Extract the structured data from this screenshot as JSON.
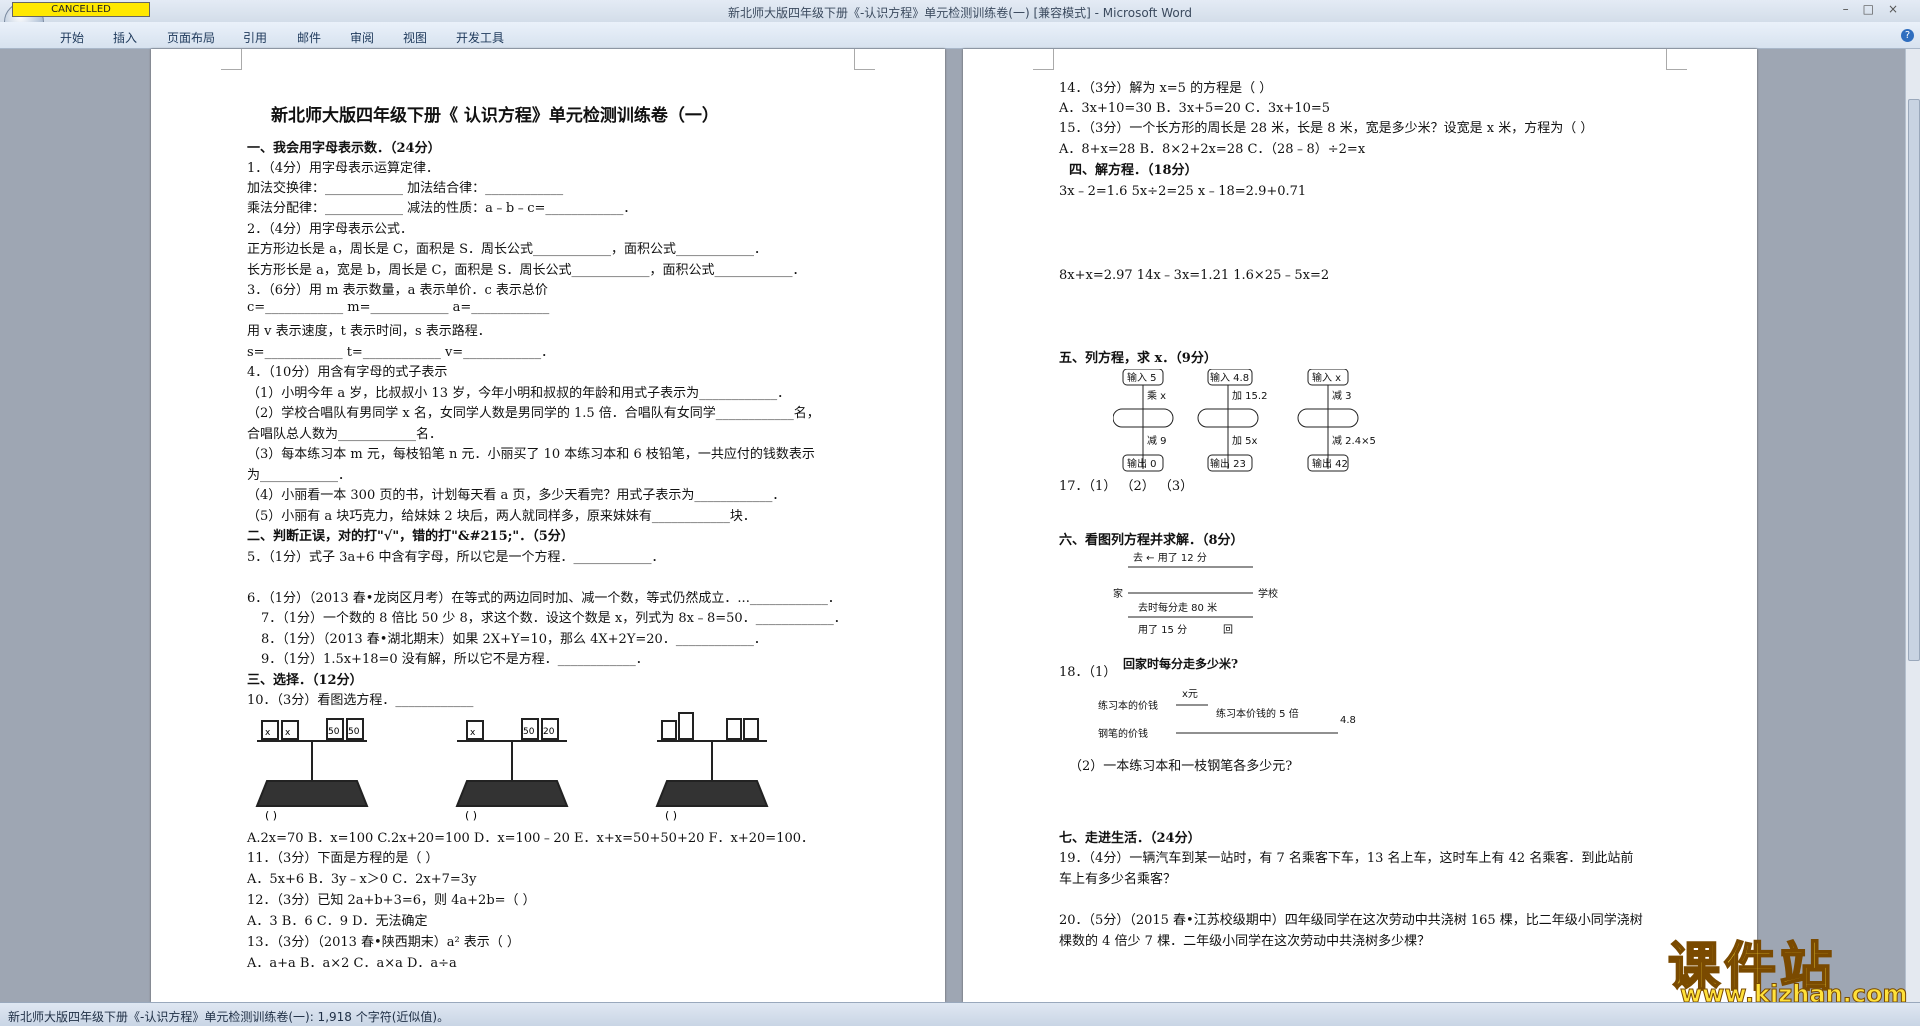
{
  "window": {
    "title": "新北师大版四年级下册《-认识方程》单元检测训练卷(一) [兼容模式] - Microsoft Word",
    "cancelled_label": "CANCELLED",
    "controls": [
      "–",
      "□",
      "×"
    ]
  },
  "ribbon": {
    "tabs": [
      "开始",
      "插入",
      "页面布局",
      "引用",
      "邮件",
      "审阅",
      "视图",
      "开发工具"
    ],
    "help": "?"
  },
  "status": {
    "text": "新北师大版四年级下册《-认识方程》单元检测训练卷(一): 1,918 个字符(近似值)。"
  },
  "watermark": {
    "logo": "课件站",
    "url": "www.kjzhan.com"
  },
  "page1": {
    "title": "新北师大版四年级下册《 认识方程》单元检测训练卷（一）",
    "lines": [
      "一、我会用字母表示数．（24分）",
      "1．（4分）用字母表示运算定律．",
      "加法交换律：____________    加法结合律：____________",
      "乘法分配律：____________    减法的性质：a﹣b﹣c=____________．",
      "2．（4分）用字母表示公式．",
      "正方形边长是 a，周长是 C，面积是 S．周长公式____________，面积公式____________．",
      "长方形长是 a，宽是 b，周长是 C，面积是 S．周长公式____________，面积公式____________．",
      "3．（6分）用 m 表示数量，a 表示单价．c 表示总价",
      "c=____________    m=____________    a=____________",
      "用 v 表示速度，t 表示时间，s 表示路程．",
      "s=____________    t=____________    v=____________．",
      "4．（10分）用含有字母的式子表示",
      "（1）小明今年 a 岁，比叔叔小 13 岁，今年小明和叔叔的年龄和用式子表示为____________．",
      "（2）学校合唱队有男同学 x 名，女同学人数是男同学的 1.5 倍．合唱队有女同学____________名，",
      "合唱队总人数为____________名．",
      "（3）每本练习本 m 元，每枝铅笔 n 元．小丽买了 10 本练习本和 6 枝铅笔，一共应付的钱数表示",
      "为____________．",
      "（4）小丽看一本 300 页的书，计划每天看 a 页，多少天看完？用式子表示为____________．",
      "（5）小丽有 a 块巧克力，给妹妹 2 块后，两人就同样多，原来妹妹有____________块．",
      "二、判断正误，对的打\"√\"，错的打\"&#215;\"．（5分）",
      "5．（1分）式子 3a+6 中含有字母，所以它是一个方程．____________．",
      "6．（1分）（2013 春•龙岗区月考）在等式的两边同时加、减一个数，等式仍然成立．...____________．",
      "7．（1分）一个数的 8 倍比 50 少 8，求这个数．设这个数是 x，列式为 8x﹣8=50．____________．",
      "8．（1分）（2013 春•湖北期末）如果 2X+Y=10，那么 4X+2Y=20．____________．",
      "9．（1分）1.5x+18=0 没有解，所以它不是方程．____________．",
      "三、选择．（12分）",
      "10．（3分）看图选方程．____________",
      "A.2x=70    B．x=100    C.2x+20=100    D．x=100﹣20    E．x+x=50+50+20    F．x+20=100．",
      "11．（3分）下面是方程的是（      ）",
      "A．5x+6                         B．3y﹣x＞0                      C．2x+7=3y",
      "12．（3分）已知 2a+b+3=6，则 4a+2b=（      ）",
      "A．3                      B．6                      C．9                      D．无法确定",
      "13．（3分）（2013 春•陕西期末）a² 表示（      ）",
      "A．a+a                     B．a×2                     C．a×a                     D．a÷a"
    ],
    "scale_labels": [
      "x",
      "50",
      "50",
      "20",
      "x",
      "50",
      "20"
    ]
  },
  "page2": {
    "lines": [
      "14．（3分）解为 x=5 的方程是（      ）",
      "A．3x+10=30                      B．3x+5=20                      C．3x+10=5",
      "15．（3分）一个长方形的周长是 28 米，长是 8 米，宽是多少米？设宽是 x 米，方程为（      ）",
      "A．8+x=28                        B．8×2+2x=28                    C．（28﹣8）÷2=x",
      "四、解方程．（18分）",
      "3x﹣2=1.6                       5x÷2=25                         x﹣18=2.9+0.71",
      "8x+x=2.97                      14x﹣3x=1.21                    1.6×25﹣5x=2",
      "五、列方程，求 x．（9分）",
      "17．（1）                        （2）                           （3）",
      "六、看图列方程并求解．（8分）",
      "18．（1）",
      "（2）一本练习本和一枝钢笔各多少元?",
      "七、走进生活．（24分）",
      "19．（4分）一辆汽车到某一站时，有 7 名乘客下车，13 名上车，这时车上有 42 名乘客．到此站前",
      "车上有多少名乘客？",
      "20．（5分）（2015 春•江苏校级期中）四年级同学在这次劳动中共浇树 165 棵，比二年级小同学浇树",
      "棵数的 4 倍少 7 棵．二年级小同学在这次劳动中共浇树多少棵？"
    ],
    "flow": [
      {
        "input": "输入 5",
        "op1": "乘 x",
        "op2": "减 9",
        "output": "输出 0"
      },
      {
        "input": "输入 4.8",
        "op1": "加 15.2",
        "op2": "加 5x",
        "output": "输出 23"
      },
      {
        "input": "输入 x",
        "op1": "减 3",
        "op2": "减 2.4×5",
        "output": "输出 42"
      }
    ],
    "diagram1": {
      "top": "去 ← 用了 12 分",
      "home": "家",
      "school": "学校",
      "speed": "去时每分走 80 米",
      "bottom": "用了 15 分",
      "back": "回",
      "question": "回家时每分走多少米?"
    },
    "diagram2": {
      "row1": "练习本的价钱",
      "xunit": "x元",
      "row2": "钢笔的价钱",
      "times": "练习本价钱的 5 倍",
      "total": "4.8 元"
    }
  }
}
